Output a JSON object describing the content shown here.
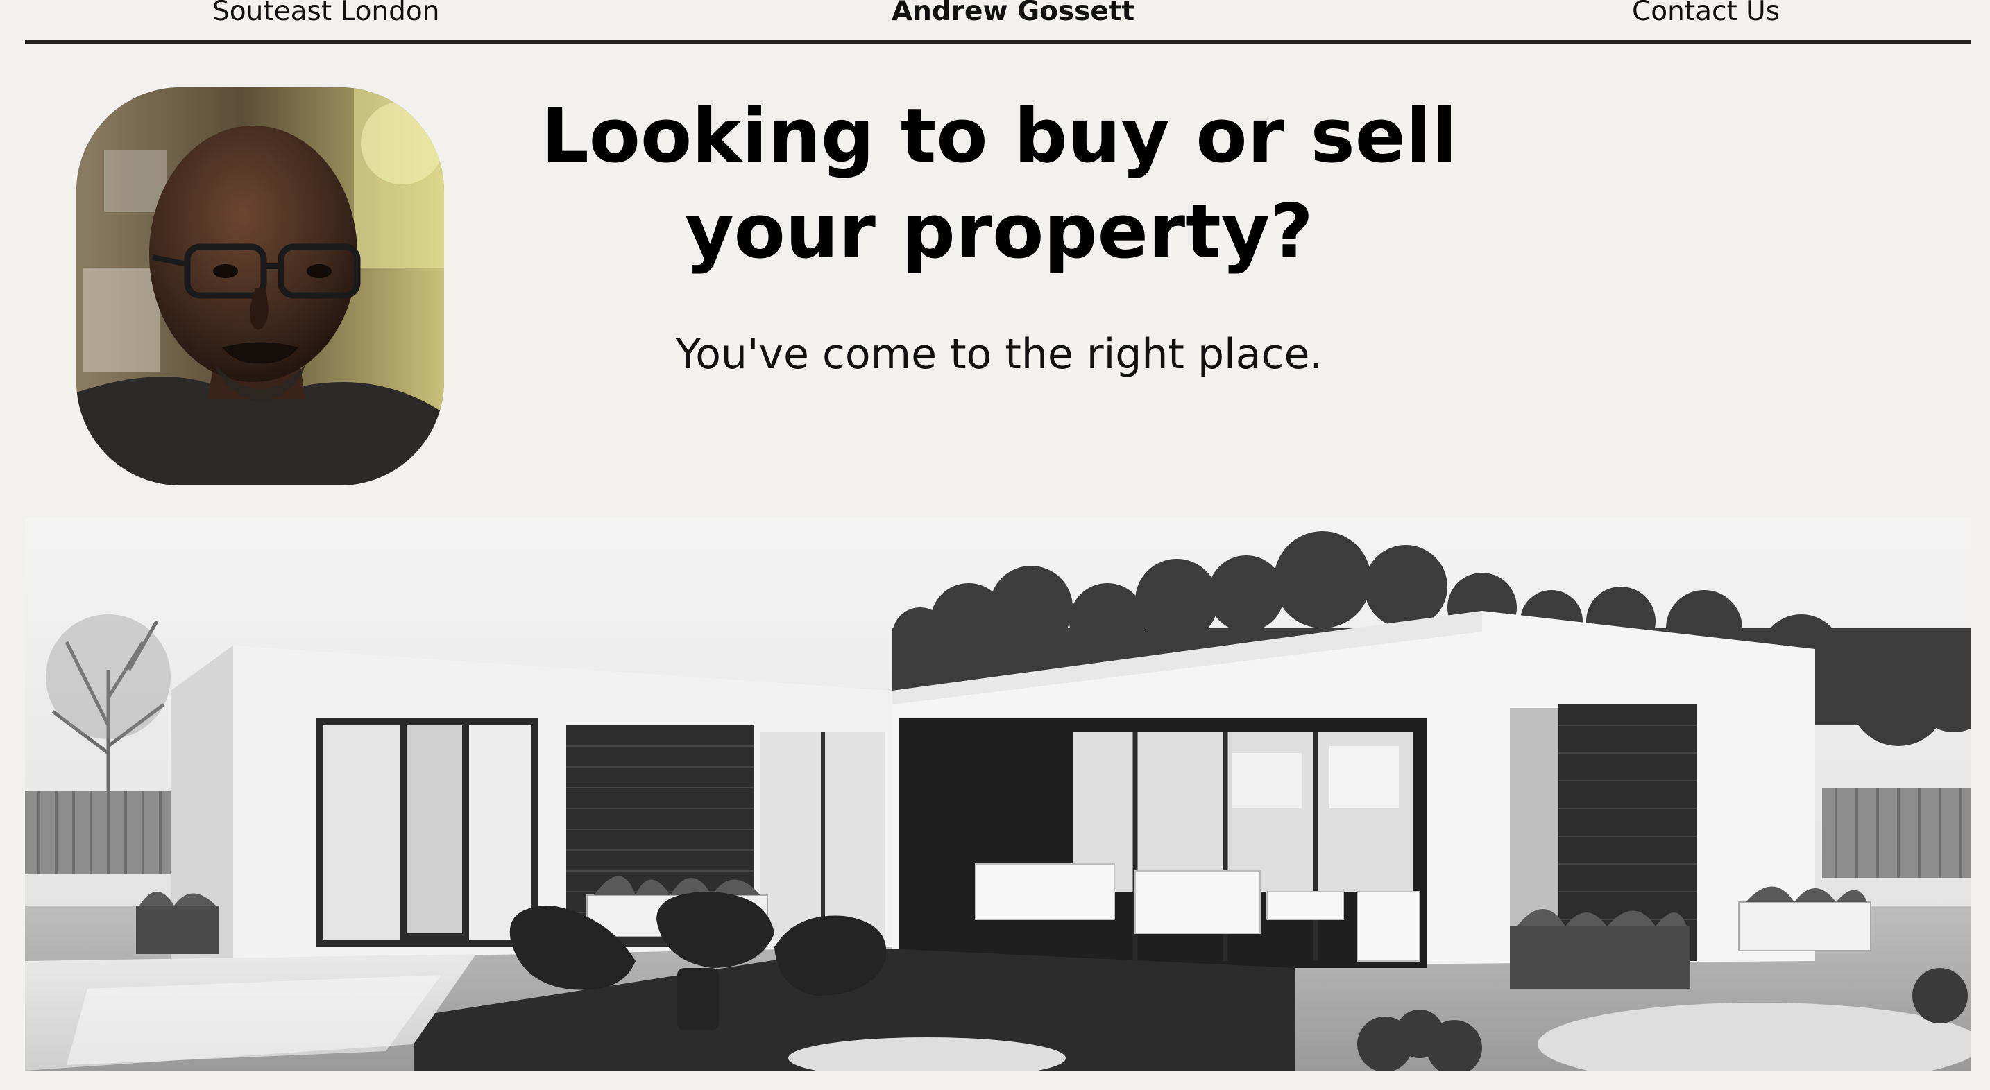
{
  "header": {
    "location_link": "Souteast London",
    "brand_name": "Andrew Gossett",
    "contact_link": "Contact Us"
  },
  "hero": {
    "title_line1": "Looking to buy or sell",
    "title_line2": "your property?",
    "subtitle": "You've come to the right place."
  },
  "colors": {
    "background": "#f3f1ed",
    "text": "#000000"
  }
}
